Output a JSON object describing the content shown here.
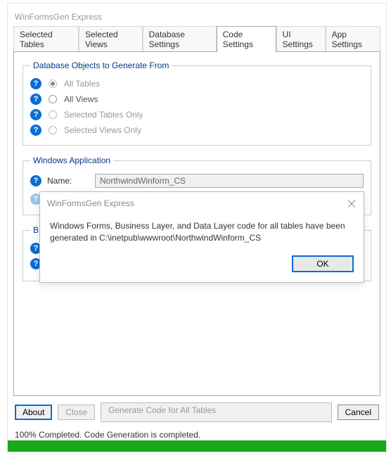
{
  "window": {
    "title": "WinFormsGen Express"
  },
  "tabs": {
    "t0": "Selected Tables",
    "t1": "Selected Views",
    "t2": "Database Settings",
    "t3": "Code Settings",
    "t4": "UI Settings",
    "t5": "App Settings"
  },
  "groupbox1": {
    "legend": "Database Objects to Generate From",
    "options": {
      "r0": "All Tables",
      "r1": "All Views",
      "r2": "Selected Tables Only",
      "r3": "Selected Views Only"
    }
  },
  "groupbox2": {
    "legend": "Windows Application",
    "name_label": "Name:",
    "name_value": "NorthwindWinform_CS"
  },
  "buttons": {
    "about": "About",
    "close": "Close",
    "generate": "Generate Code for All Tables",
    "cancel": "Cancel"
  },
  "status_text": "100% Completed.  Code Generation is completed.",
  "dialog": {
    "title": "WinFormsGen Express",
    "body": "Windows Forms, Business Layer, and Data Layer code for all tables have been generated in C:\\inetpub\\wwwroot\\NorthwindWinform_CS",
    "ok": "OK"
  },
  "help_glyph": "?"
}
